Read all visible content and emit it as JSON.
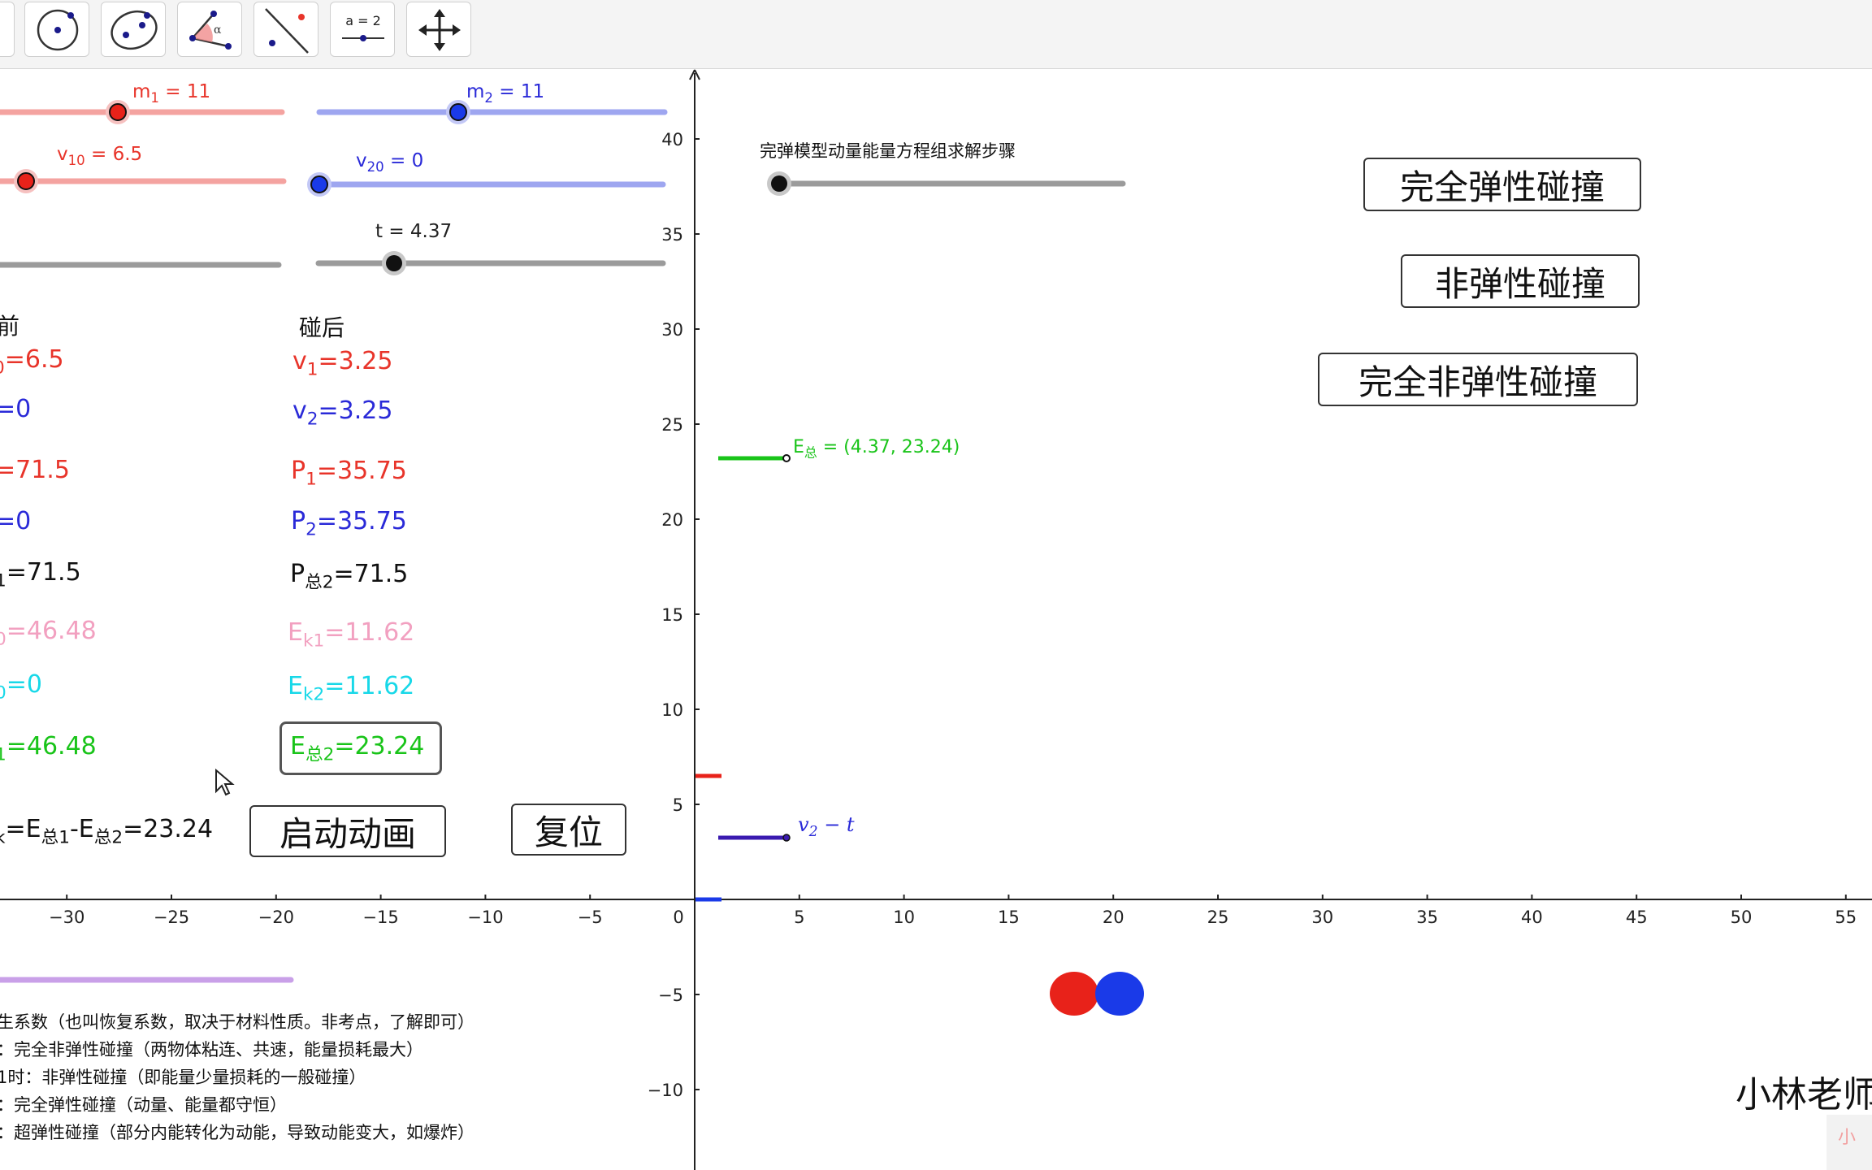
{
  "colors": {
    "red": "#e8342a",
    "blue": "#2a2ad8",
    "green": "#19c419",
    "pink": "#f2a0c0",
    "cyan": "#18d8e8",
    "gray_slider": "#9b9b9b",
    "violet_slider": "#c9a0e8"
  },
  "toolbar": {
    "tools": [
      {
        "name": "circle-center-point-tool",
        "icon": "circle-center-point-icon"
      },
      {
        "name": "ellipse-tool",
        "icon": "ellipse-icon"
      },
      {
        "name": "angle-tool",
        "icon": "angle-icon",
        "glyph": "α"
      },
      {
        "name": "reflect-line-tool",
        "icon": "reflect-about-line-icon"
      },
      {
        "name": "slider-tool",
        "icon": "slider-icon",
        "label": "a = 2"
      },
      {
        "name": "move-graphics-tool",
        "icon": "move-arrows-icon"
      }
    ]
  },
  "sliders": {
    "m1": {
      "sym": "m",
      "sub": "1",
      "value": "11"
    },
    "m2": {
      "sym": "m",
      "sub": "2",
      "value": "11"
    },
    "v10": {
      "sym": "v",
      "sub": "10",
      "value": "6.5"
    },
    "v20": {
      "sym": "v",
      "sub": "20",
      "value": "0"
    },
    "t": {
      "label": "t = 4.37"
    },
    "steps": {
      "label": "完弹模型动量能量方程组求解步骤"
    }
  },
  "headers": {
    "before": "前",
    "after": "碰后"
  },
  "before": {
    "v1": "=6.5",
    "v2": "=0",
    "p1": "=71.5",
    "p2": "=0",
    "ptotal_sub": "1",
    "ptotal": "=71.5",
    "ek1_sub": "0",
    "ek1": "=46.48",
    "ek2_sub": "0",
    "ek2": "=0",
    "etotal_sub": "1",
    "etotal": "=46.48"
  },
  "after": {
    "v1": {
      "sym": "v",
      "sub": "1",
      "value": "=3.25"
    },
    "v2": {
      "sym": "v",
      "sub": "2",
      "value": "=3.25"
    },
    "p1": {
      "sym": "P",
      "sub": "1",
      "value": "=35.75"
    },
    "p2": {
      "sym": "P",
      "sub": "2",
      "value": "=35.75"
    },
    "ptotal": {
      "sym": "P",
      "sub": "总2",
      "value": "=71.5"
    },
    "ek1": {
      "sym": "E",
      "sub": "k1",
      "value": "=11.62"
    },
    "ek2": {
      "sym": "E",
      "sub": "k2",
      "value": "=11.62"
    },
    "etotal": {
      "sym": "E",
      "sub": "总2",
      "value": "=23.24"
    }
  },
  "loss": {
    "lead_sub": "k",
    "eq": "=E",
    "sub1": "总1",
    "minus": "-E",
    "sub2": "总2",
    "value": "=23.24"
  },
  "buttons": {
    "start": "启动动画",
    "reset": "复位",
    "elastic": "完全弹性碰撞",
    "inelastic": "非弹性碰撞",
    "perfectly_inelastic": "完全非弹性碰撞"
  },
  "graph": {
    "etotal_label": {
      "sym": "E",
      "sub": "总",
      "value": " = (4.37, 23.24)"
    },
    "v2t_label": {
      "sym": "v",
      "sub": "2",
      "rest": " − t"
    },
    "x_ticks": [
      -30,
      -25,
      -20,
      -15,
      -10,
      -5,
      0,
      5,
      10,
      15,
      20,
      25,
      30,
      35,
      40,
      45,
      50,
      55
    ],
    "y_ticks": [
      -10,
      -5,
      5,
      10,
      15,
      20,
      25,
      30,
      35,
      40
    ]
  },
  "notes": [
    "生系数（也叫恢复系数，取决于材料性质。非考点，了解即可）",
    "：完全非弹性碰撞（两物体粘连、共速，能量损耗最大）",
    "1时：非弹性碰撞（即能量少量损耗的一般碰撞）",
    "：完全弹性碰撞（动量、能量都守恒）",
    "：超弹性碰撞（部分内能转化为动能，导致动能变大，如爆炸）"
  ],
  "watermark": {
    "main": "小林老师",
    "small": "小"
  }
}
